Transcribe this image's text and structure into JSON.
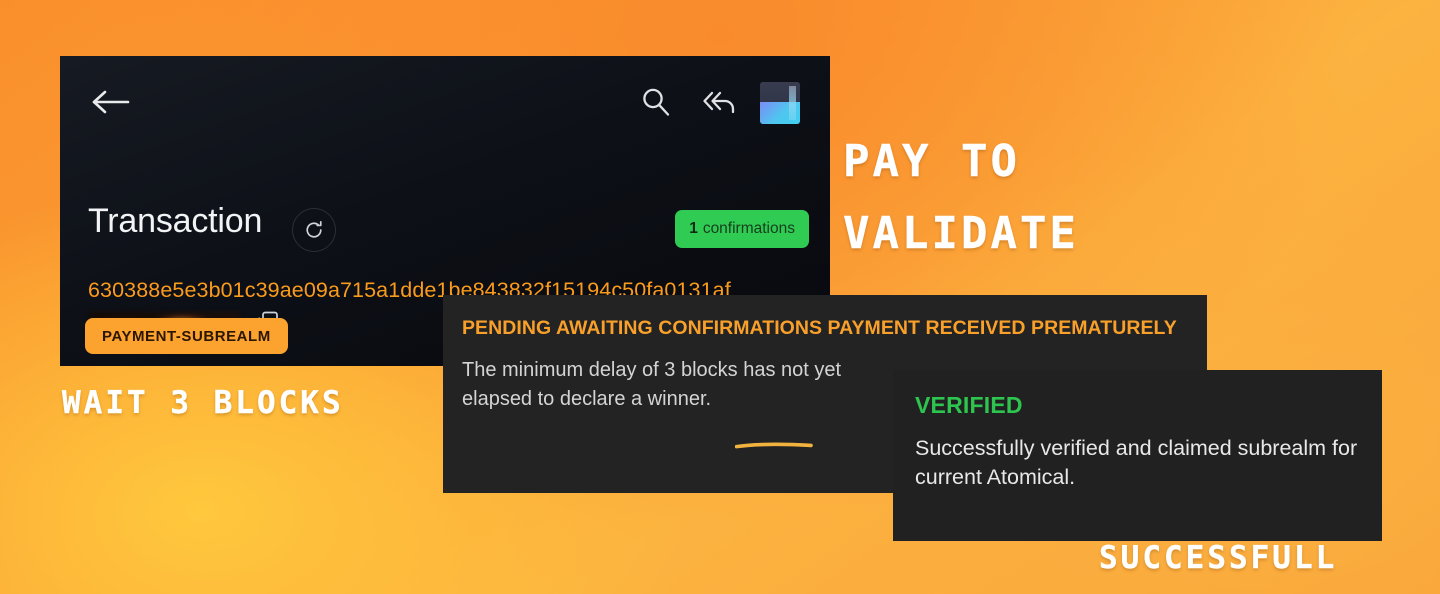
{
  "background": {
    "gradient_from": "#f98f2b",
    "gradient_mid": "#fcb340",
    "gradient_to": "#ffc83d"
  },
  "app_card": {
    "toolbar": {
      "back_icon": "back-arrow-icon",
      "search_icon": "search-icon",
      "reply_all_icon": "reply-all-icon",
      "app_logo_icon": "app-logo-icon"
    },
    "title": "Transaction",
    "refresh_icon": "refresh-icon",
    "confirmations": {
      "count": "1",
      "label": "confirmations",
      "color": "#2fcb53"
    },
    "tx_hash": "630388e5e3b01c39ae09a715a1dde1be843832f15194c50fa0131af",
    "copy_icon": "copy-icon",
    "redacted_label": "",
    "type_badge": {
      "label": "PAYMENT-SUBREALM",
      "color": "#fca22e"
    }
  },
  "pending_panel": {
    "title": "PENDING AWAITING CONFIRMATIONS PAYMENT RECEIVED PREMATURELY",
    "body": "The minimum delay of 3 blocks has not yet elapsed to declare a winner.",
    "highlight_word": "3 blocks",
    "title_color": "#f9a02a",
    "underline_color": "#f2b33e"
  },
  "verified_panel": {
    "title": "VERIFIED",
    "body": "Successfully verified and claimed subrealm for current Atomical.",
    "title_color": "#2dc44f"
  },
  "annotations": {
    "pay_to": "PAY TO",
    "validate": "VALIDATE",
    "wait_blocks": "WAIT 3 BLOCKS",
    "successfull": "SUCCESSFULL"
  }
}
